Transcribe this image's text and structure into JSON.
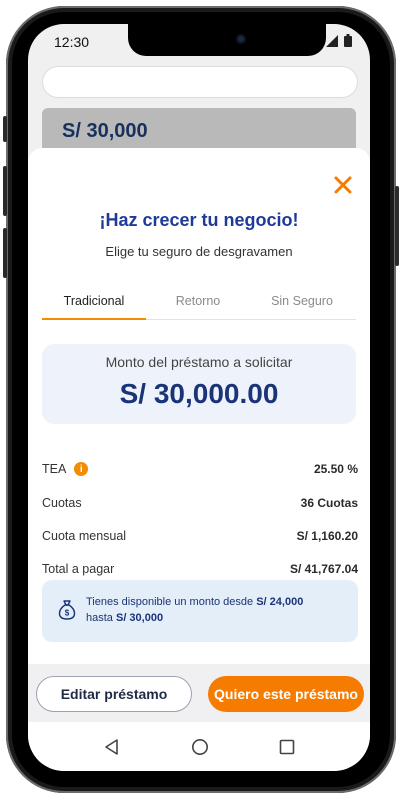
{
  "status_bar": {
    "time": "12:30"
  },
  "background_card": {
    "amount": "S/ 30,000"
  },
  "modal": {
    "title": "¡Haz crecer tu negocio!",
    "subtitle": "Elige tu seguro de desgravamen",
    "tabs": [
      {
        "label": "Tradicional",
        "active": true
      },
      {
        "label": "Retorno",
        "active": false
      },
      {
        "label": "Sin Seguro",
        "active": false
      }
    ],
    "amount_label": "Monto del préstamo a solicitar",
    "amount_value": "S/ 30,000.00",
    "details": [
      {
        "label": "TEA",
        "value": "25.50 %"
      },
      {
        "label": "Cuotas",
        "value": "36 Cuotas"
      },
      {
        "label": "Cuota mensual",
        "value": "S/ 1,160.20"
      },
      {
        "label": "Total a pagar",
        "value": "S/ 41,767.04"
      }
    ],
    "info_icon_glyph": "i",
    "notice": {
      "text_prefix": "Tienes disponible un monto desde",
      "min_amount": "S/ 24,000",
      "text_middle": "hasta",
      "max_amount": "S/ 30,000"
    }
  },
  "buttons": {
    "edit_label": "Editar préstamo",
    "confirm_label": "Quiero este préstamo"
  },
  "icons": {
    "close": "close-icon",
    "info": "info-icon",
    "money_bag": "money-bag-icon",
    "nav_back": "back-icon",
    "nav_home": "home-icon",
    "nav_recents": "recents-icon"
  },
  "colors": {
    "accent_orange": "#f57c00",
    "title_blue": "#1f3a9a",
    "amount_blue": "#1a3477"
  }
}
